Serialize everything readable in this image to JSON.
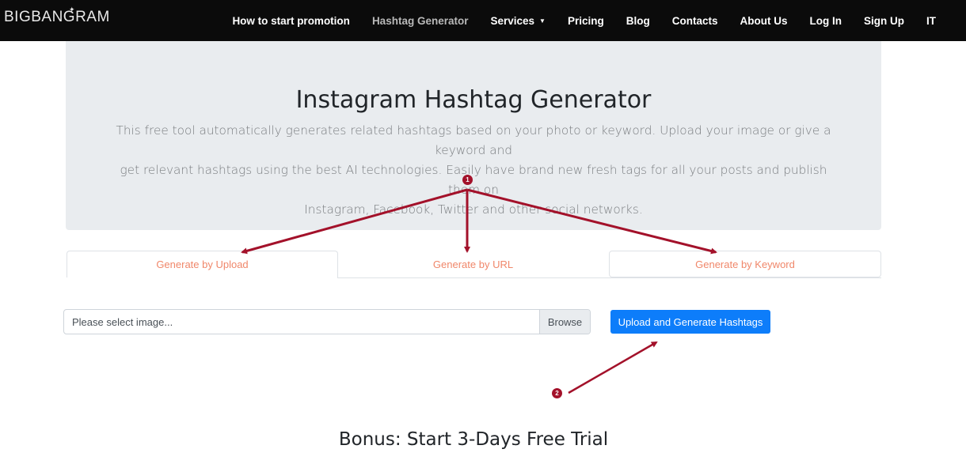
{
  "navbar": {
    "logo": "BIGBANGRAM",
    "items": [
      {
        "label": "How to start promotion"
      },
      {
        "label": "Hashtag Generator"
      },
      {
        "label": "Services"
      },
      {
        "label": "Pricing"
      },
      {
        "label": "Blog"
      },
      {
        "label": "Contacts"
      },
      {
        "label": "About Us"
      },
      {
        "label": "Log In"
      },
      {
        "label": "Sign Up"
      },
      {
        "label": "IT"
      }
    ],
    "active_item": "Hashtag Generator"
  },
  "hero": {
    "title": "Instagram Hashtag Generator",
    "description_lines": [
      "This free tool automatically generates related hashtags based on your photo or keyword. Upload your image or give a keyword and",
      "get relevant hashtags using the best AI technologies. Easily have brand new fresh tags for all your posts and publish them on",
      "Instagram, Facebook, Twitter and other social networks."
    ]
  },
  "tabs": [
    {
      "label": "Generate by Upload",
      "active": true
    },
    {
      "label": "Generate by URL",
      "active": false
    },
    {
      "label": "Generate by Keyword",
      "active": false
    }
  ],
  "upload": {
    "file_placeholder": "Please select image...",
    "browse_label": "Browse",
    "submit_label": "Upload and Generate Hashtags"
  },
  "bonus": {
    "title": "Bonus: Start 3-Days Free Trial"
  },
  "annotations": {
    "badge_1": "1",
    "badge_2": "2"
  },
  "colors": {
    "navbar_bg": "#0b0b0b",
    "hero_bg": "#e9ecef",
    "tab_text": "#f0876a",
    "primary_button": "#0d7dfa",
    "annotation": "#a3112a"
  },
  "icons": {
    "services_dropdown": "caret-down-icon",
    "logo_mark": "star-icon"
  }
}
